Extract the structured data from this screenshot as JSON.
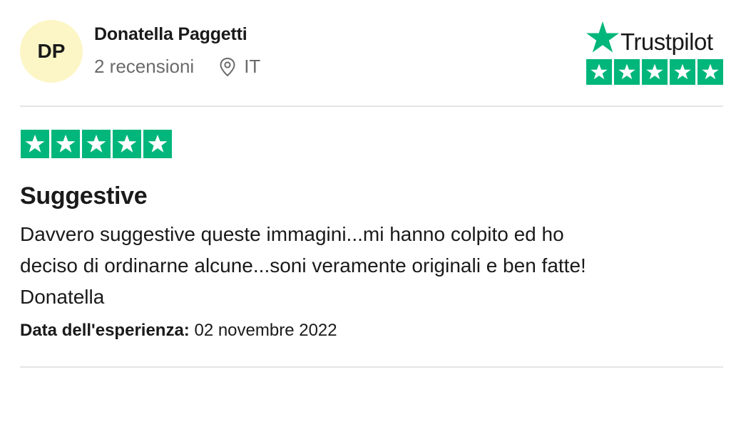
{
  "reviewer": {
    "initials": "DP",
    "name": "Donatella Paggetti",
    "reviews_count": "2 recensioni",
    "country": "IT"
  },
  "brand": {
    "logo_text": "Trustpilot",
    "star_rating": 5,
    "color": "#00b67a"
  },
  "review": {
    "rating": 5,
    "title": "Suggestive",
    "body_line1": "Davvero suggestive queste immagini...mi hanno colpito ed ho",
    "body_line2": "deciso di ordinarne alcune...soni veramente originali e ben fatte!",
    "body_line3": "Donatella",
    "experience_label": "Data dell'esperienza:",
    "experience_date": "02 novembre 2022"
  },
  "icons": {
    "location": "location-pin-icon",
    "star": "star-icon"
  },
  "colors": {
    "avatar_bg": "#fcf6c6",
    "meta_text": "#6b6b6b",
    "divider": "#e5e5e5"
  }
}
